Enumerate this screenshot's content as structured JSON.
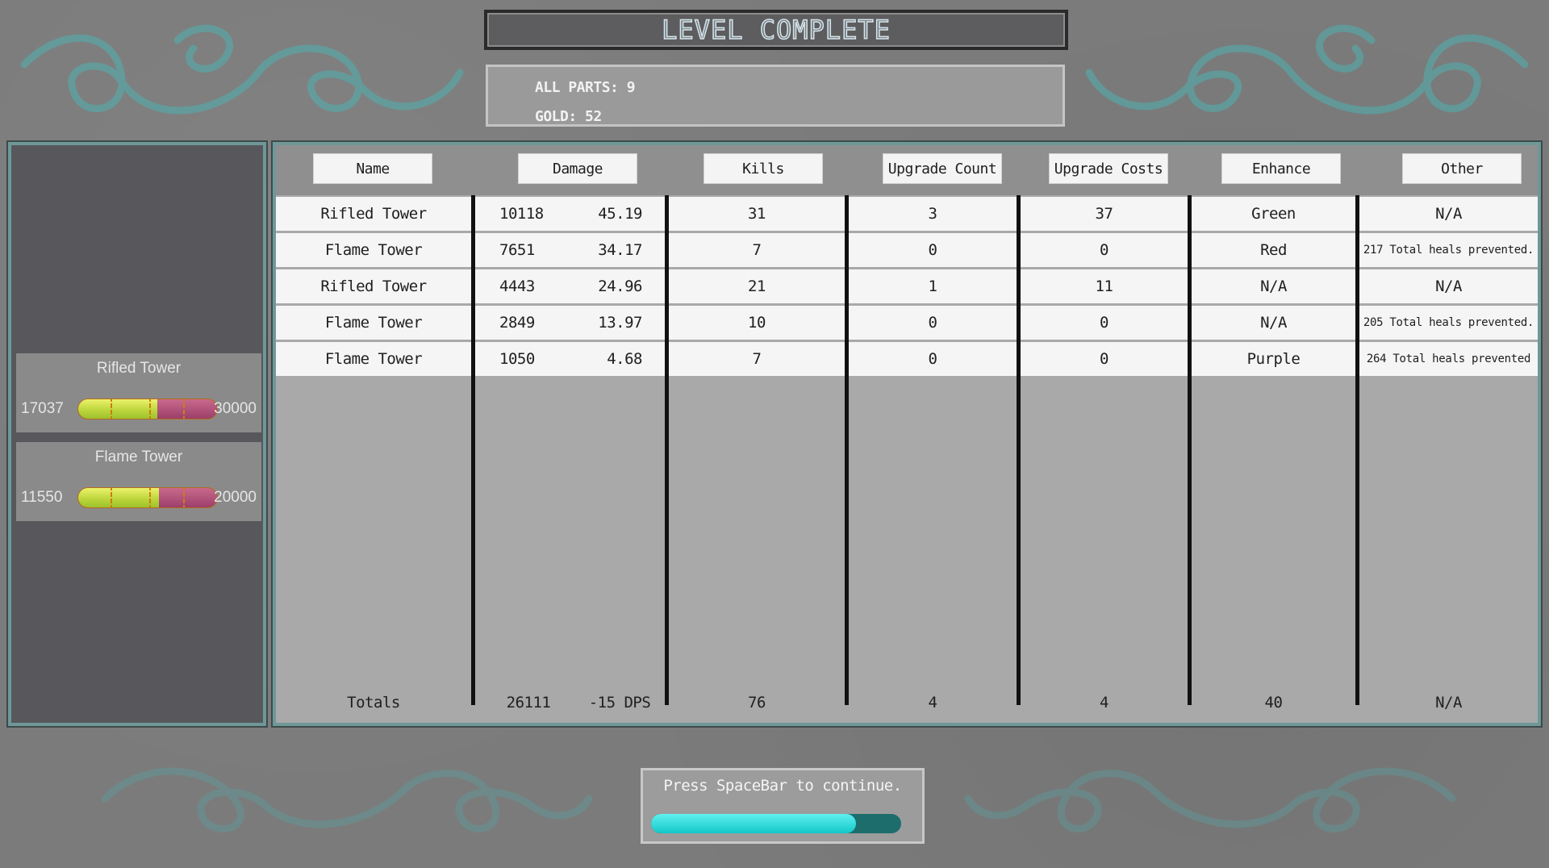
{
  "title": "LEVEL COMPLETE",
  "stats": {
    "all_parts": "ALL PARTS: 9",
    "gold": "GOLD: 52"
  },
  "towers": [
    {
      "name": "Rifled Tower",
      "low": "17037",
      "high": "30000",
      "health_fraction": 0.57
    },
    {
      "name": "Flame Tower",
      "low": "11550",
      "high": "20000",
      "health_fraction": 0.58
    }
  ],
  "table": {
    "headers": [
      "Name",
      "Damage",
      "Kills",
      "Upgrade Count",
      "Upgrade Costs",
      "Enhance",
      "Other"
    ],
    "rows": [
      {
        "name": "Rifled Tower",
        "damage": "10118",
        "dps": "45.19",
        "kills": "31",
        "upgrade_count": "3",
        "upgrade_costs": "37",
        "enhance": "Green",
        "other": "N/A"
      },
      {
        "name": "Flame Tower",
        "damage": "7651",
        "dps": "34.17",
        "kills": "7",
        "upgrade_count": "0",
        "upgrade_costs": "0",
        "enhance": "Red",
        "other": "217 Total heals prevented."
      },
      {
        "name": "Rifled Tower",
        "damage": "4443",
        "dps": "24.96",
        "kills": "21",
        "upgrade_count": "1",
        "upgrade_costs": "11",
        "enhance": "N/A",
        "other": "N/A"
      },
      {
        "name": "Flame Tower",
        "damage": "2849",
        "dps": "13.97",
        "kills": "10",
        "upgrade_count": "0",
        "upgrade_costs": "0",
        "enhance": "N/A",
        "other": "205 Total heals prevented."
      },
      {
        "name": "Flame Tower",
        "damage": "1050",
        "dps": "4.68",
        "kills": "7",
        "upgrade_count": "0",
        "upgrade_costs": "0",
        "enhance": "Purple",
        "other": "264 Total heals prevented"
      }
    ],
    "totals": {
      "label": "Totals",
      "damage": "26111",
      "dps": "-15 DPS",
      "kills": "76",
      "upgrade_count": "4",
      "upgrade_costs": "4",
      "enhance": "40",
      "other": "N/A"
    }
  },
  "continue": {
    "text": "Press SpaceBar to continue.",
    "progress": 0.82
  },
  "colors": {
    "accent_teal": "#4fb0b0",
    "panel_border": "#6f9898",
    "health_green": "#c8dc48",
    "health_magenta": "#b0527c",
    "progress_cyan": "#13c8c8"
  }
}
